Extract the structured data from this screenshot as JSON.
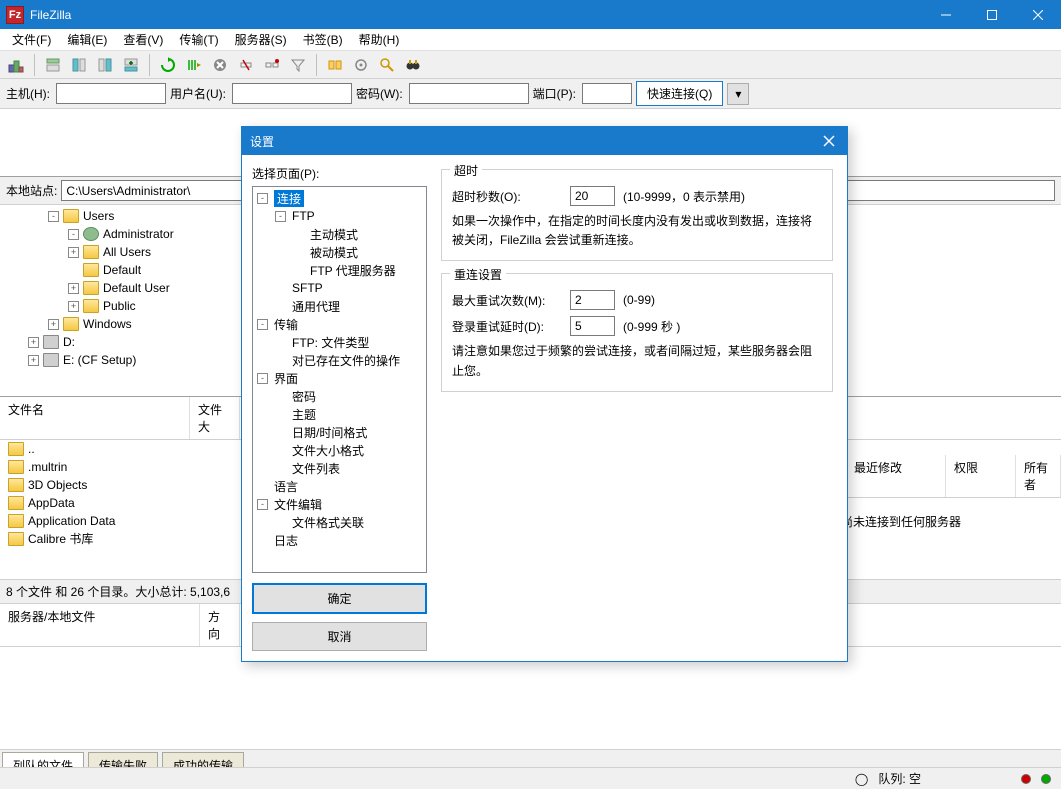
{
  "titlebar": {
    "title": "FileZilla"
  },
  "menu": {
    "file": "文件(F)",
    "edit": "编辑(E)",
    "view": "查看(V)",
    "transfer": "传输(T)",
    "server": "服务器(S)",
    "bookmarks": "书签(B)",
    "help": "帮助(H)"
  },
  "quickconnect": {
    "host_label": "主机(H):",
    "user_label": "用户名(U):",
    "pass_label": "密码(W):",
    "port_label": "端口(P):",
    "connect_btn": "快速连接(Q)"
  },
  "local": {
    "site_label": "本地站点:",
    "site_path": "C:\\Users\\Administrator\\",
    "tree": [
      {
        "indent": 2,
        "exp": "-",
        "icon": "folder",
        "label": "Users"
      },
      {
        "indent": 3,
        "exp": "-",
        "icon": "user",
        "label": "Administrator"
      },
      {
        "indent": 3,
        "exp": "+",
        "icon": "folder",
        "label": "All Users"
      },
      {
        "indent": 3,
        "exp": " ",
        "icon": "folder",
        "label": "Default"
      },
      {
        "indent": 3,
        "exp": "+",
        "icon": "folder",
        "label": "Default User"
      },
      {
        "indent": 3,
        "exp": "+",
        "icon": "folder",
        "label": "Public"
      },
      {
        "indent": 2,
        "exp": "+",
        "icon": "folder",
        "label": "Windows"
      },
      {
        "indent": 1,
        "exp": "+",
        "icon": "drive",
        "label": "D:"
      },
      {
        "indent": 1,
        "exp": "+",
        "icon": "drive",
        "label": "E: (CF Setup)"
      }
    ],
    "columns": {
      "name": "文件名",
      "size": "文件大"
    },
    "files": [
      {
        "name": "..",
        "icon": "folder"
      },
      {
        "name": ".multrin",
        "icon": "folder"
      },
      {
        "name": "3D Objects",
        "icon": "folder"
      },
      {
        "name": "AppData",
        "icon": "folder"
      },
      {
        "name": "Application Data",
        "icon": "folder"
      },
      {
        "name": "Calibre 书库",
        "icon": "folder"
      }
    ],
    "status": "8 个文件 和 26 个目录。大小总计: 5,103,6"
  },
  "remote": {
    "columns": {
      "modified": "最近修改",
      "perm": "权限",
      "owner": "所有者"
    },
    "msg": "尚未连接到任何服务器"
  },
  "queue": {
    "col1": "服务器/本地文件",
    "col2": "方向",
    "tabs": {
      "queued": "列队的文件",
      "failed": "传输失败",
      "success": "成功的传输"
    }
  },
  "statusbar": {
    "queue_label": "队列: 空"
  },
  "dialog": {
    "title": "设置",
    "page_label": "选择页面(P):",
    "tree": [
      {
        "d": 0,
        "exp": "-",
        "label": "连接",
        "sel": true
      },
      {
        "d": 1,
        "exp": "-",
        "label": "FTP"
      },
      {
        "d": 2,
        "exp": "",
        "label": "主动模式"
      },
      {
        "d": 2,
        "exp": "",
        "label": "被动模式"
      },
      {
        "d": 2,
        "exp": "",
        "label": "FTP 代理服务器"
      },
      {
        "d": 1,
        "exp": "",
        "label": "SFTP"
      },
      {
        "d": 1,
        "exp": "",
        "label": "通用代理"
      },
      {
        "d": 0,
        "exp": "-",
        "label": "传输"
      },
      {
        "d": 1,
        "exp": "",
        "label": "FTP: 文件类型"
      },
      {
        "d": 1,
        "exp": "",
        "label": "对已存在文件的操作"
      },
      {
        "d": 0,
        "exp": "-",
        "label": "界面"
      },
      {
        "d": 1,
        "exp": "",
        "label": "密码"
      },
      {
        "d": 1,
        "exp": "",
        "label": "主题"
      },
      {
        "d": 1,
        "exp": "",
        "label": "日期/时间格式"
      },
      {
        "d": 1,
        "exp": "",
        "label": "文件大小格式"
      },
      {
        "d": 1,
        "exp": "",
        "label": "文件列表"
      },
      {
        "d": 0,
        "exp": "",
        "label": "语言"
      },
      {
        "d": 0,
        "exp": "-",
        "label": "文件编辑"
      },
      {
        "d": 1,
        "exp": "",
        "label": "文件格式关联"
      },
      {
        "d": 0,
        "exp": "",
        "label": "日志"
      }
    ],
    "ok": "确定",
    "cancel": "取消",
    "timeout": {
      "legend": "超时",
      "seconds_label": "超时秒数(O):",
      "seconds_value": "20",
      "seconds_hint": "(10-9999，0 表示禁用)",
      "desc": "如果一次操作中，在指定的时间长度内没有发出或收到数据，连接将被关闭，FileZilla 会尝试重新连接。"
    },
    "reconnect": {
      "legend": "重连设置",
      "max_label": "最大重试次数(M):",
      "max_value": "2",
      "max_hint": "(0-99)",
      "delay_label": "登录重试延时(D):",
      "delay_value": "5",
      "delay_hint": "(0-999 秒 )",
      "desc": "请注意如果您过于频繁的尝试连接，或者间隔过短，某些服务器会阻止您。"
    }
  }
}
